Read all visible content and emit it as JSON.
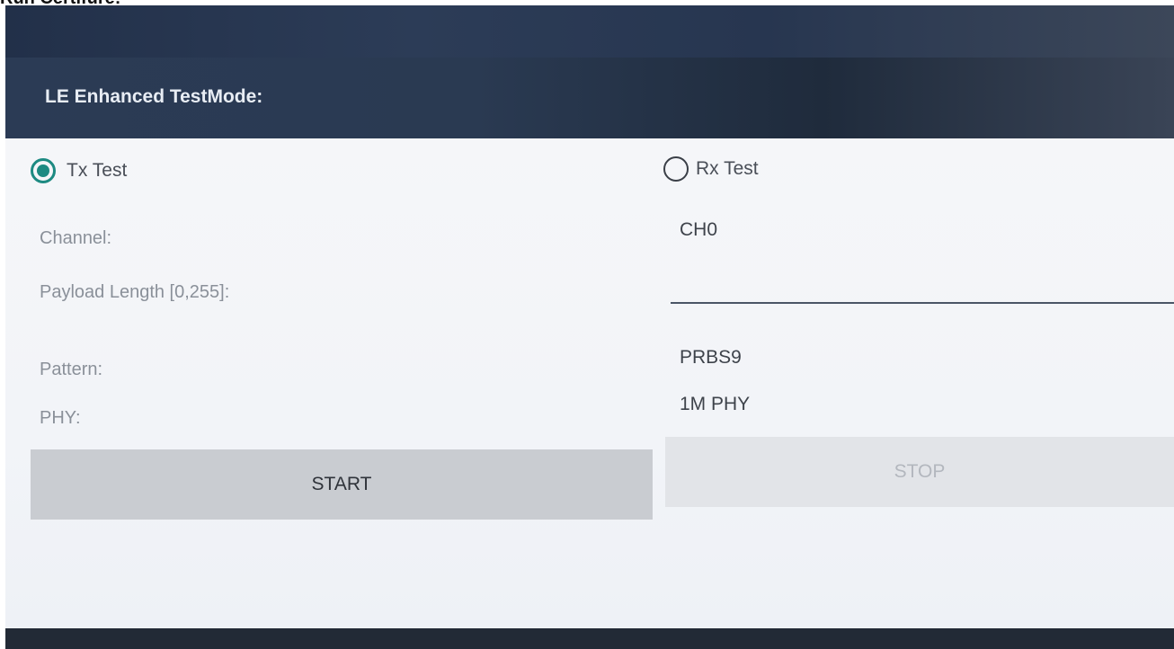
{
  "caption": "Run Certifure:",
  "dialog": {
    "title": "LE Enhanced TestMode:"
  },
  "mode": {
    "tx_label": "Tx Test",
    "rx_label": "Rx Test",
    "selected": "Tx Test"
  },
  "fields": {
    "channel_label": "Channel:",
    "channel_value": "CH0",
    "payload_label": "Payload Length [0,255]:",
    "payload_value": "",
    "pattern_label": "Pattern:",
    "pattern_value": "PRBS9",
    "phy_label": "PHY:",
    "phy_value": "1M PHY"
  },
  "buttons": {
    "start_label": "START",
    "stop_label": "STOP"
  },
  "colors": {
    "accent": "#1d8a82",
    "title_bar": "#2a3a52",
    "panel": "#f3f5f8"
  }
}
